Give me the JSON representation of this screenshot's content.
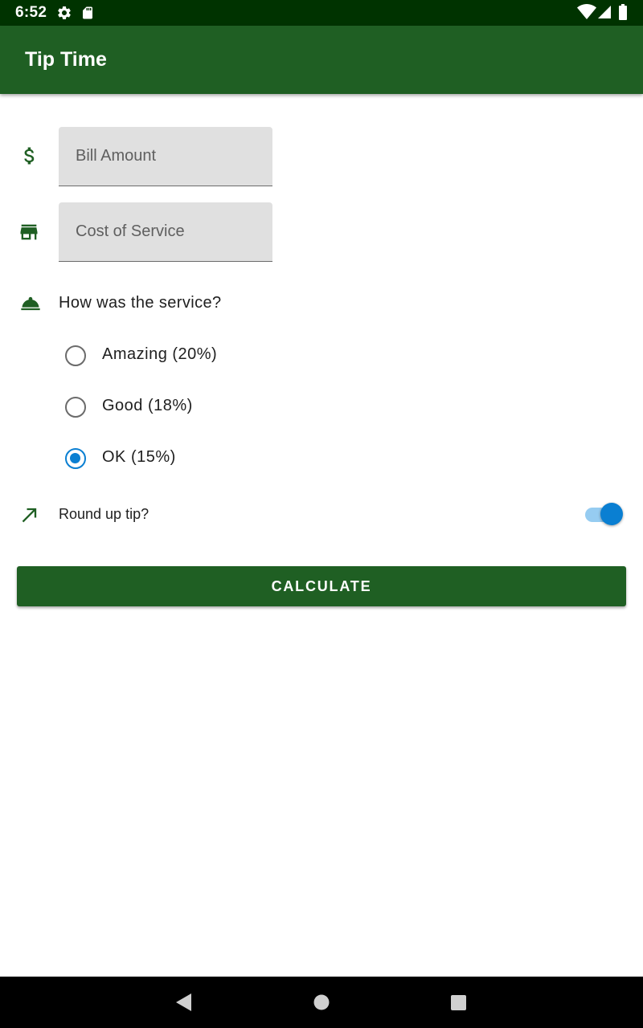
{
  "status_bar": {
    "time": "6:52",
    "icons": [
      "settings-icon",
      "sd-card-icon",
      "wifi-icon",
      "signal-icon",
      "battery-icon"
    ]
  },
  "app_bar": {
    "title": "Tip Time"
  },
  "form": {
    "bill_amount": {
      "placeholder": "Bill Amount",
      "value": "",
      "icon": "dollar-icon"
    },
    "cost_of_service": {
      "placeholder": "Cost of Service",
      "value": "",
      "icon": "storefront-icon"
    },
    "service_question": {
      "label": "How was the service?",
      "icon": "room-service-icon"
    },
    "tip_options": [
      {
        "label": "Amazing (20%)",
        "checked": false
      },
      {
        "label": "Good (18%)",
        "checked": false
      },
      {
        "label": "OK (15%)",
        "checked": true
      }
    ],
    "round_up": {
      "label": "Round up tip?",
      "on": true,
      "icon": "trending-up-icon"
    },
    "calculate_label": "CALCULATE"
  },
  "colors": {
    "primary": "#1f5f23",
    "primary_dark": "#003300",
    "accent": "#0a7fd2",
    "field_bg": "#e0e0e0"
  },
  "nav_bar": {
    "buttons": [
      "back-icon",
      "home-icon",
      "recents-icon"
    ]
  }
}
